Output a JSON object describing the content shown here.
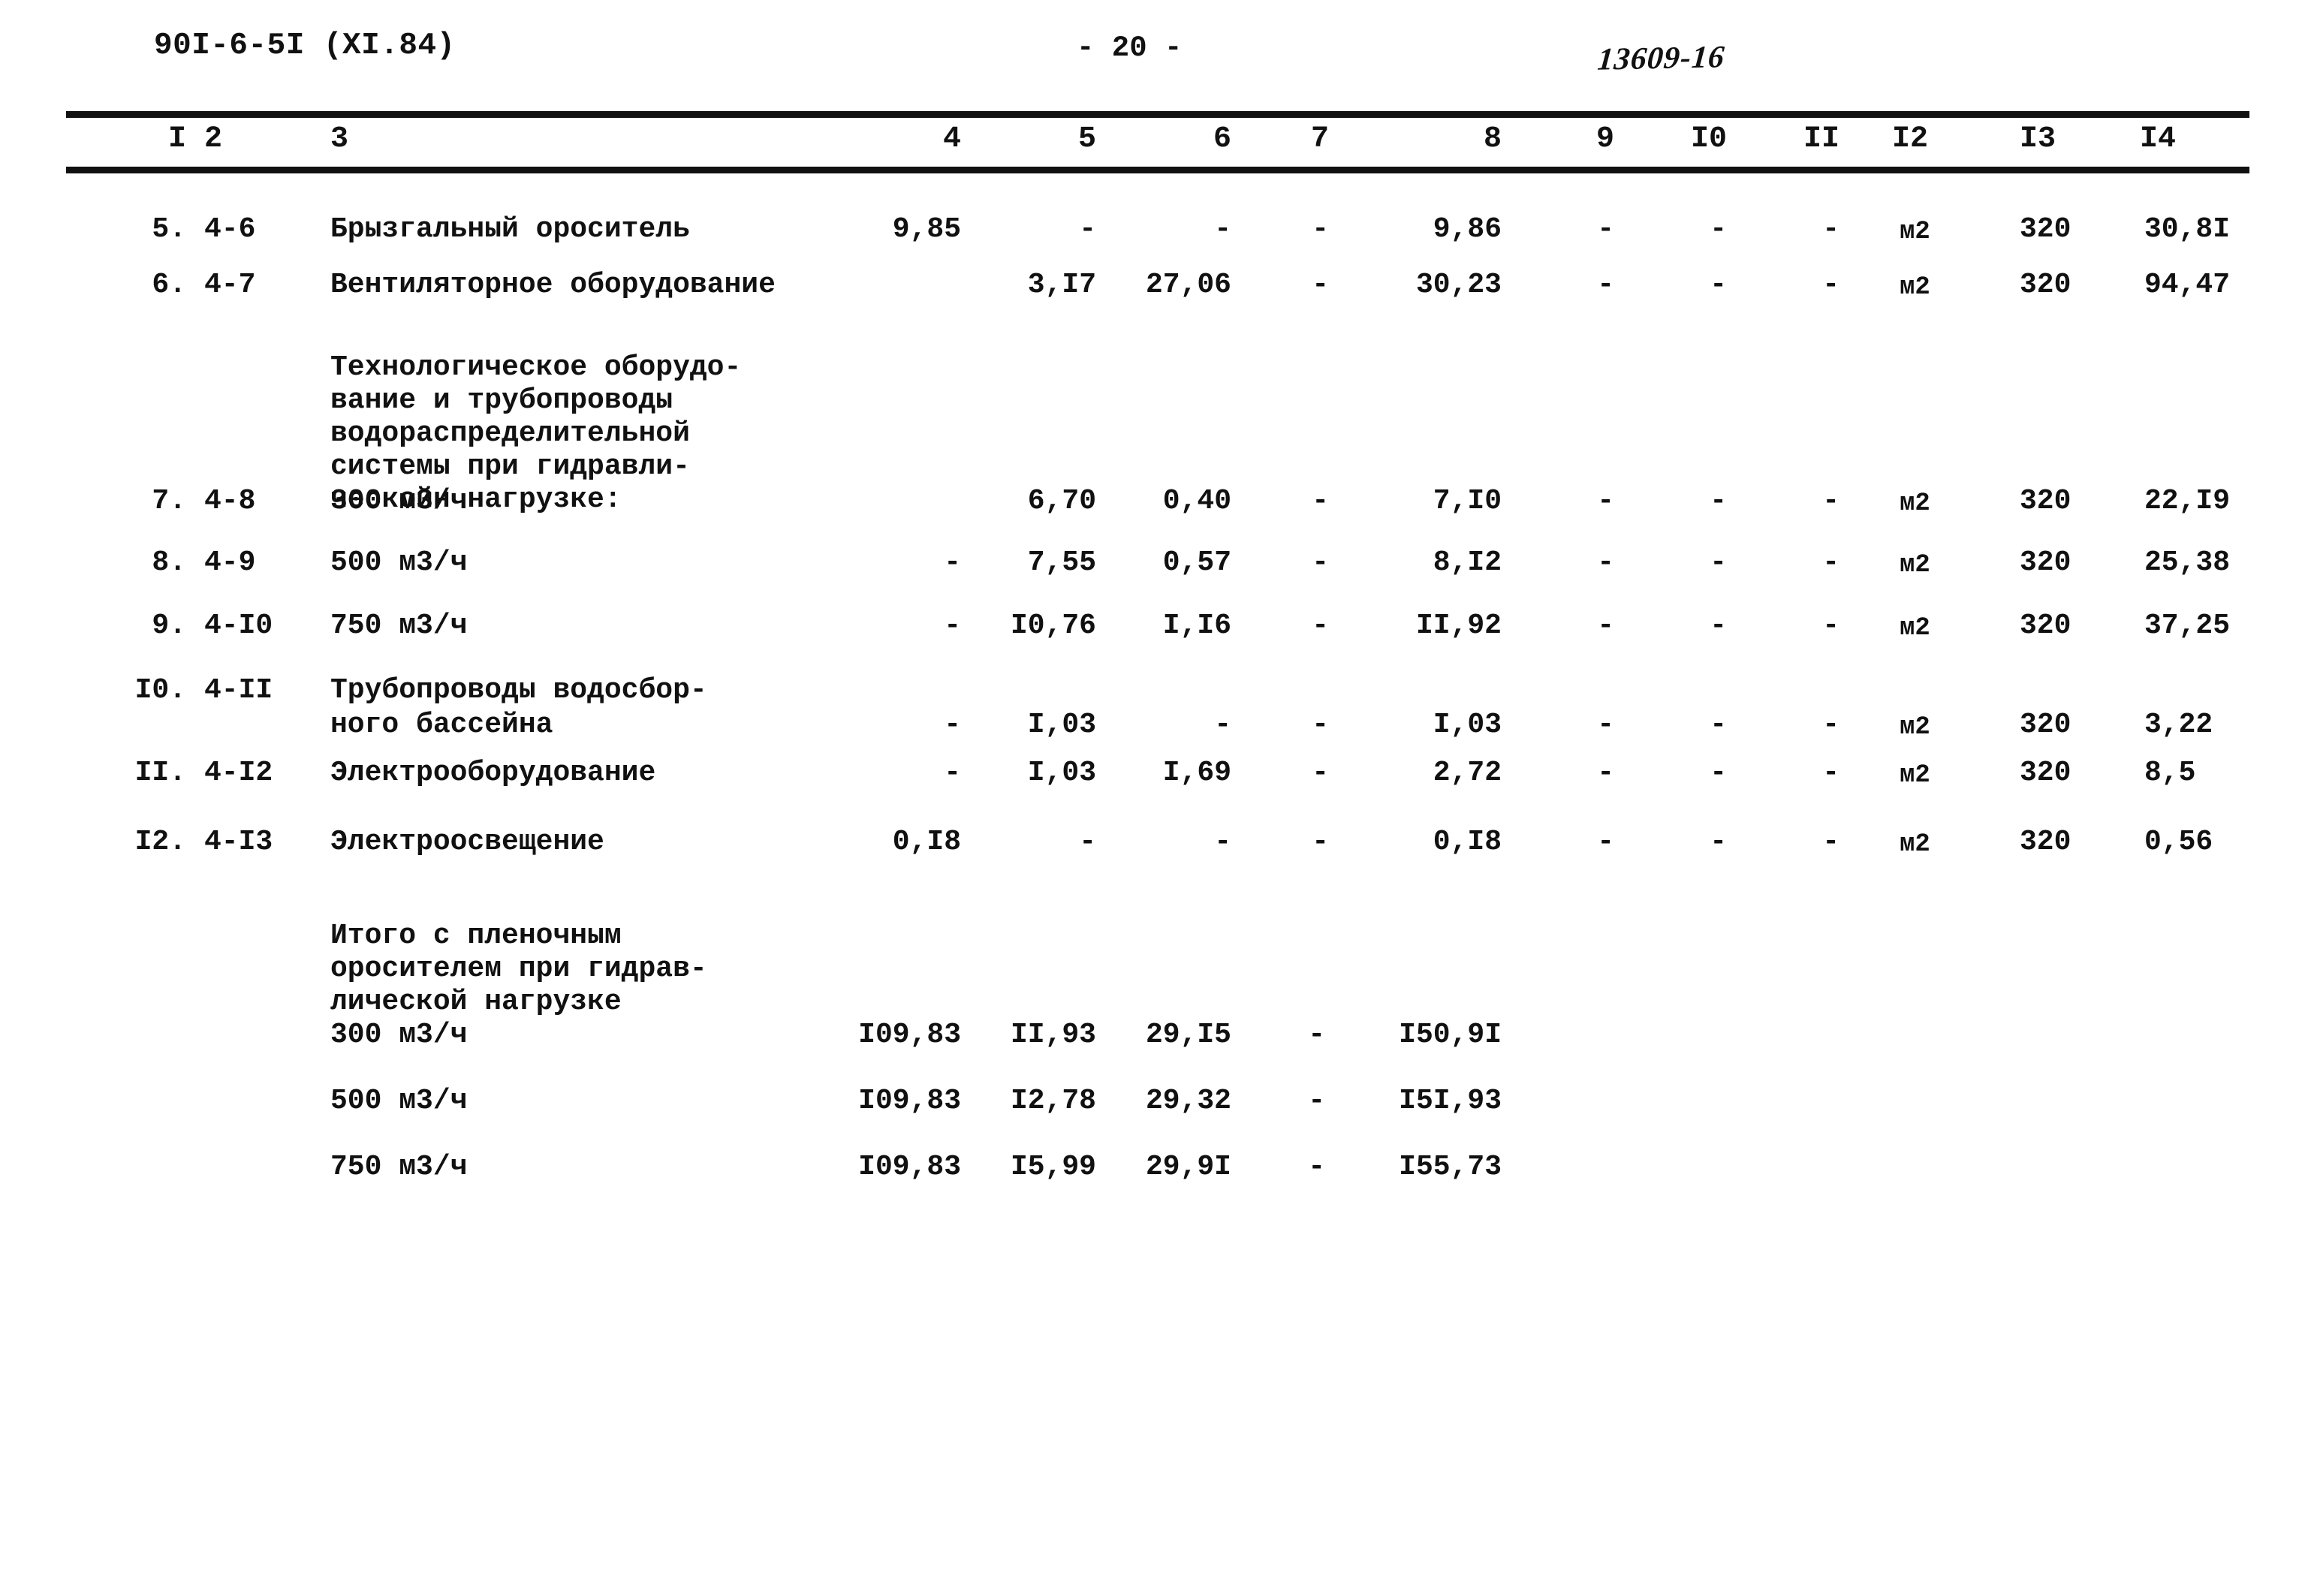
{
  "header": {
    "doc_code": "90I-6-5I (XI.84)",
    "page_number": "- 20 -",
    "stamp_number": "13609-16"
  },
  "table": {
    "column_headers": [
      "I",
      "2",
      "3",
      "4",
      "5",
      "6",
      "7",
      "8",
      "9",
      "I0",
      "II",
      "I2",
      "I3",
      "I4"
    ],
    "rows": [
      {
        "num": "5.",
        "code": "4-6",
        "name": "Брызгальный ороситель",
        "c4": "9,85",
        "c5": "-",
        "c6": "-",
        "c7": "-",
        "c8": "9,86",
        "c9": "-",
        "c10": "-",
        "c11": "-",
        "c12": "м2",
        "c13": "320",
        "c14": "30,8I"
      },
      {
        "num": "6.",
        "code": "4-7",
        "name": "Вентиляторное оборудование",
        "c4": "",
        "c5": "3,I7",
        "c6": "27,06",
        "c7": "-",
        "c8": "30,23",
        "c9": "-",
        "c10": "-",
        "c11": "-",
        "c12": "м2",
        "c13": "320",
        "c14": "94,47"
      },
      {
        "num": "7.",
        "code": "4-8",
        "name": "300 м3/ч",
        "c4": "",
        "c5": "6,70",
        "c6": "0,40",
        "c7": "-",
        "c8": "7,I0",
        "c9": "-",
        "c10": "-",
        "c11": "-",
        "c12": "м2",
        "c13": "320",
        "c14": "22,I9"
      },
      {
        "num": "8.",
        "code": "4-9",
        "name": "500 м3/ч",
        "c4": "-",
        "c5": "7,55",
        "c6": "0,57",
        "c7": "-",
        "c8": "8,I2",
        "c9": "-",
        "c10": "-",
        "c11": "-",
        "c12": "м2",
        "c13": "320",
        "c14": "25,38"
      },
      {
        "num": "9.",
        "code": "4-I0",
        "name": "750 м3/ч",
        "c4": "-",
        "c5": "I0,76",
        "c6": "I,I6",
        "c7": "-",
        "c8": "II,92",
        "c9": "-",
        "c10": "-",
        "c11": "-",
        "c12": "м2",
        "c13": "320",
        "c14": "37,25"
      },
      {
        "num": "I0.",
        "code": "4-II",
        "name": "Трубопроводы водосбор-\nного бассейна",
        "c4": "-",
        "c5": "I,03",
        "c6": "-",
        "c7": "-",
        "c8": "I,03",
        "c9": "-",
        "c10": "-",
        "c11": "-",
        "c12": "м2",
        "c13": "320",
        "c14": "3,22"
      },
      {
        "num": "II.",
        "code": "4-I2",
        "name": "Электрооборудование",
        "c4": "-",
        "c5": "I,03",
        "c6": "I,69",
        "c7": "-",
        "c8": "2,72",
        "c9": "-",
        "c10": "-",
        "c11": "-",
        "c12": "м2",
        "c13": "320",
        "c14": "8,5"
      },
      {
        "num": "I2.",
        "code": "4-I3",
        "name": "Электроосвещение",
        "c4": "0,I8",
        "c5": "-",
        "c6": "-",
        "c7": "-",
        "c8": "0,I8",
        "c9": "-",
        "c10": "-",
        "c11": "-",
        "c12": "м2",
        "c13": "320",
        "c14": "0,56"
      }
    ],
    "group_note": "Технологическое оборудо-\nвание и трубопроводы\nводораспределительной\nсистемы при гидравли-\nческойн нагрузке:",
    "total_note": "Итого с пленочным\nоросителем при гидрав-\nлической нагрузке",
    "total_rows": [
      {
        "name": "300 м3/ч",
        "c4": "I09,83",
        "c5": "II,93",
        "c6": "29,I5",
        "c7": "-",
        "c8": "I50,9I"
      },
      {
        "name": "500 м3/ч",
        "c4": "I09,83",
        "c5": "I2,78",
        "c6": "29,32",
        "c7": "-",
        "c8": "I5I,93"
      },
      {
        "name": "750 м3/ч",
        "c4": "I09,83",
        "c5": "I5,99",
        "c6": "29,9I",
        "c7": "-",
        "c8": "I55,73"
      }
    ]
  }
}
